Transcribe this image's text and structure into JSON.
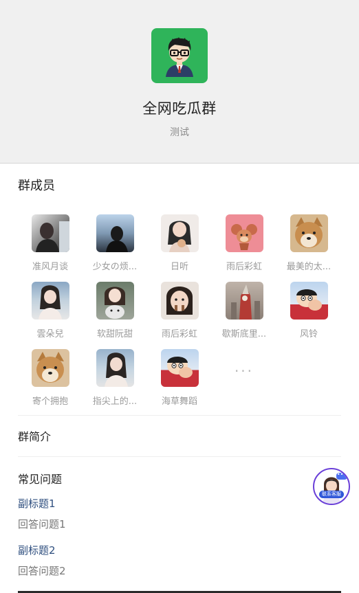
{
  "group": {
    "name": "全网吃瓜群",
    "subtitle": "测试"
  },
  "members_section": {
    "title": "群成员",
    "members": [
      {
        "name": "准风月谈"
      },
      {
        "name": "少女の烦..."
      },
      {
        "name": "日听"
      },
      {
        "name": "雨后彩虹"
      },
      {
        "name": "最美的太..."
      },
      {
        "name": "雲朵兒"
      },
      {
        "name": "软甜阮甜"
      },
      {
        "name": "雨后彩虹"
      },
      {
        "name": "歇斯底里..."
      },
      {
        "name": "风铃"
      },
      {
        "name": "寄个拥抱"
      },
      {
        "name": "指尖上的..."
      },
      {
        "name": "海草舞蹈"
      }
    ],
    "more_label": "..."
  },
  "intro_section": {
    "title": "群简介"
  },
  "faq_section": {
    "title": "常见问题",
    "items": [
      {
        "question": "副标题1",
        "answer": "回答问题1"
      },
      {
        "question": "副标题2",
        "answer": "回答问题2"
      }
    ]
  },
  "customer_service": {
    "label": "联系客服"
  },
  "colors": {
    "group_avatar": "#2fb45a",
    "faq_question": "#2f4f7f",
    "cs_ring": "#6a3fd8"
  }
}
